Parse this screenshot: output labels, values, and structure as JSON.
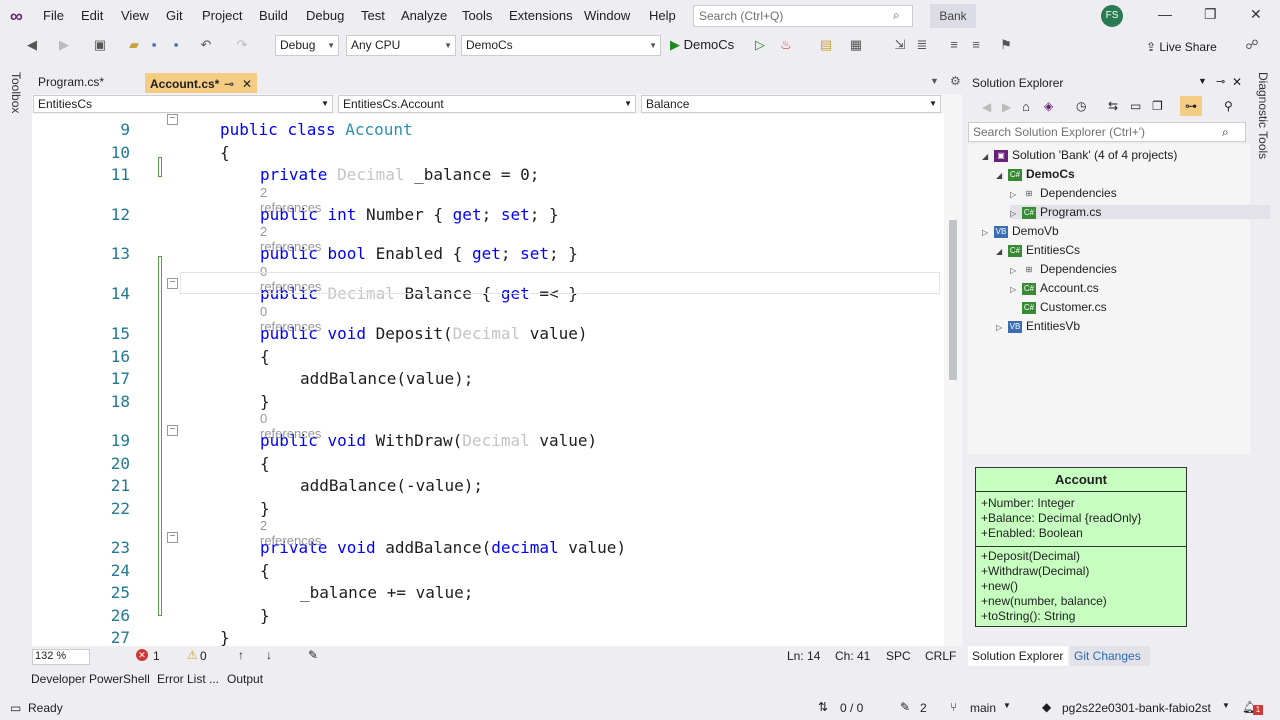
{
  "menu": [
    "File",
    "Edit",
    "View",
    "Git",
    "Project",
    "Build",
    "Debug",
    "Test",
    "Analyze",
    "Tools",
    "Extensions",
    "Window",
    "Help"
  ],
  "search_placeholder": "Search (Ctrl+Q)",
  "solution_name": "Bank",
  "user_initials": "FS",
  "toolbar": {
    "config": "Debug",
    "platform": "Any CPU",
    "startup_project": "DemoCs",
    "run_label": "DemoCs",
    "live_share": "Live Share"
  },
  "side_labels": {
    "toolbox": "Toolbox",
    "diagnostic": "Diagnostic Tools"
  },
  "tabs": [
    {
      "label": "Program.cs*"
    },
    {
      "label": "Account.cs*",
      "pin": "⊸",
      "close": "✕"
    }
  ],
  "navbar": {
    "project": "EntitiesCs",
    "type": "EntitiesCs.Account",
    "member": "Balance"
  },
  "code_lines": [
    {
      "num": "9",
      "ref": "",
      "text": "public class Account"
    },
    {
      "num": "10",
      "ref": "",
      "text": "{"
    },
    {
      "num": "11",
      "ref": "",
      "text": "private Decimal _balance = 0;"
    },
    {
      "num": "12",
      "ref": "2 references",
      "text": "public int Number { get; set; }"
    },
    {
      "num": "13",
      "ref": "2 references",
      "text": "public bool Enabled { get; set; }"
    },
    {
      "num": "14",
      "ref": "0 references",
      "text": "public Decimal Balance { get =< }"
    },
    {
      "num": "15",
      "ref": "0 references",
      "text": "public void Deposit(Decimal value)"
    },
    {
      "num": "16",
      "ref": "",
      "text": "{"
    },
    {
      "num": "17",
      "ref": "",
      "text": "addBalance(value);"
    },
    {
      "num": "18",
      "ref": "",
      "text": "}"
    },
    {
      "num": "19",
      "ref": "0 references",
      "text": "public void WithDraw(Decimal value)"
    },
    {
      "num": "20",
      "ref": "",
      "text": "{"
    },
    {
      "num": "21",
      "ref": "",
      "text": "addBalance(-value);"
    },
    {
      "num": "22",
      "ref": "",
      "text": "}"
    },
    {
      "num": "23",
      "ref": "2 references",
      "text": "private void addBalance(decimal value)"
    },
    {
      "num": "24",
      "ref": "",
      "text": "{"
    },
    {
      "num": "25",
      "ref": "",
      "text": "_balance += value;"
    },
    {
      "num": "26",
      "ref": "",
      "text": "}"
    },
    {
      "num": "27",
      "ref": "",
      "text": "}"
    }
  ],
  "editor_status": {
    "zoom": "132 %",
    "errors": "1",
    "warnings": "0",
    "line": "Ln: 14",
    "col": "Ch: 41",
    "spc": "SPC",
    "crlf": "CRLF"
  },
  "solution_explorer": {
    "title": "Solution Explorer",
    "search_placeholder": "Search Solution Explorer (Ctrl+')",
    "tree": [
      {
        "label": "Solution 'Bank' (4 of 4 projects)",
        "icon": "solution"
      },
      {
        "label": "DemoCs",
        "icon": "csproj",
        "bold": true
      },
      {
        "label": "Dependencies",
        "icon": "deps"
      },
      {
        "label": "Program.cs",
        "icon": "csfile"
      },
      {
        "label": "DemoVb",
        "icon": "vbproj"
      },
      {
        "label": "EntitiesCs",
        "icon": "csproj"
      },
      {
        "label": "Dependencies",
        "icon": "deps"
      },
      {
        "label": "Account.cs",
        "icon": "csfile"
      },
      {
        "label": "Customer.cs",
        "icon": "csfile"
      },
      {
        "label": "EntitiesVb",
        "icon": "vbproj"
      }
    ],
    "tabs": [
      "Solution Explorer",
      "Git Changes"
    ]
  },
  "uml": {
    "title": "Account",
    "attributes": [
      "+Number: Integer",
      "+Balance: Decimal {readOnly}",
      "+Enabled: Boolean"
    ],
    "methods": [
      "+Deposit(Decimal)",
      "+Withdraw(Decimal)",
      "+new()",
      "+new(number, balance)",
      "+toString(): String"
    ]
  },
  "bottom_tabs": [
    "Developer PowerShell",
    "Error List ...",
    "Output"
  ],
  "statusbar": {
    "ready": "Ready",
    "sync": "0 / 0",
    "edits": "2",
    "branch": "main",
    "repo": "pg2s22e0301-bank-fabio2st",
    "notifications": "1"
  },
  "colors": {
    "accent": "#68217a",
    "keyword": "#0000ff",
    "type": "#2b91af",
    "uml_fill": "#c6ffc0"
  }
}
